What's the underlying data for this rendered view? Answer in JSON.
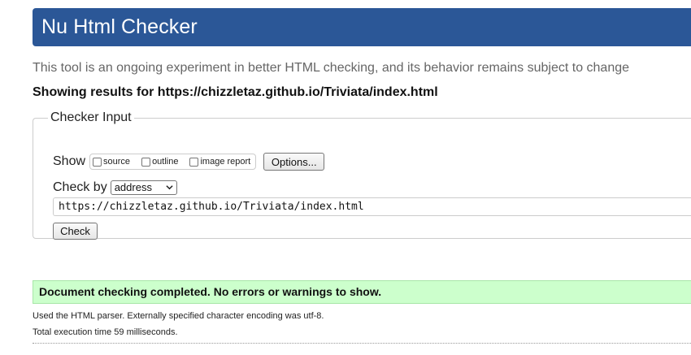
{
  "header": {
    "title": "Nu Html Checker",
    "background_color": "#2b5797"
  },
  "intro": "This tool is an ongoing experiment in better HTML checking, and its behavior remains subject to change",
  "results_for": "Showing results for https://chizzletaz.github.io/Triviata/index.html",
  "checker_input": {
    "legend": "Checker Input",
    "show_label": "Show",
    "show_options": [
      {
        "label": "source",
        "checked": false
      },
      {
        "label": "outline",
        "checked": false
      },
      {
        "label": "image report",
        "checked": false
      }
    ],
    "options_button": "Options...",
    "check_by_label": "Check by",
    "check_by_selected": "address",
    "url_value": "https://chizzletaz.github.io/Triviata/index.html",
    "check_button": "Check"
  },
  "result": {
    "message": "Document checking completed. No errors or warnings to show.",
    "background_color": "#ccffcc",
    "parser_info": "Used the HTML parser. Externally specified character encoding was utf-8.",
    "execution_time": "Total execution time 59 milliseconds."
  }
}
